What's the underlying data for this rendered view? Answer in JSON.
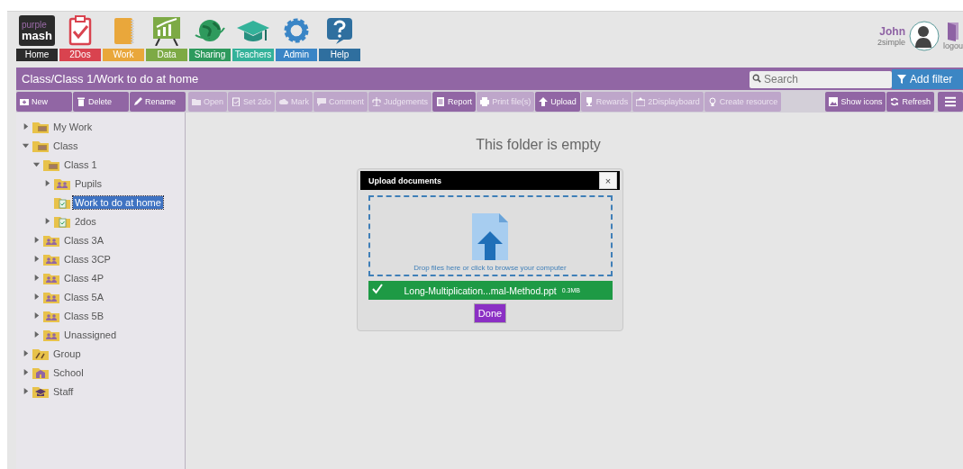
{
  "header": {
    "logo": {
      "line1": "purple",
      "line2": "mash"
    },
    "nav": [
      {
        "label": "Home",
        "color": "#2b2b2b",
        "kind": "logo"
      },
      {
        "label": "2Dos",
        "color": "#d9434f",
        "kind": "clipboard"
      },
      {
        "label": "Work",
        "color": "#e9a73b",
        "kind": "notebook"
      },
      {
        "label": "Data",
        "color": "#7daa45",
        "kind": "chart"
      },
      {
        "label": "Sharing",
        "color": "#2e9a5d",
        "kind": "globe"
      },
      {
        "label": "Teachers",
        "color": "#34b29a",
        "kind": "cap"
      },
      {
        "label": "Admin",
        "color": "#3a85c6",
        "kind": "gear"
      },
      {
        "label": "Help",
        "color": "#2f6f9f",
        "kind": "help"
      }
    ],
    "user": {
      "name": "John",
      "org": "2simple",
      "logout": "logou"
    }
  },
  "path_bar": {
    "path": "Class/Class 1/Work to do at home",
    "search_placeholder": "Search",
    "filter_button": "Add filter"
  },
  "toolbar": {
    "left": [
      {
        "label": "New",
        "kind": "new",
        "disabled": false
      },
      {
        "label": "Delete",
        "kind": "trash",
        "disabled": false
      },
      {
        "label": "Rename",
        "kind": "pencil",
        "disabled": false
      }
    ],
    "main": [
      {
        "label": "Open",
        "kind": "folder",
        "disabled": true
      },
      {
        "label": "Set 2do",
        "kind": "clipboard",
        "disabled": true
      },
      {
        "label": "Mark",
        "kind": "cloud",
        "disabled": true
      },
      {
        "label": "Comment",
        "kind": "speech",
        "disabled": true
      },
      {
        "label": "Judgements",
        "kind": "scale",
        "disabled": true
      },
      {
        "label": "Report",
        "kind": "doc",
        "disabled": false
      },
      {
        "label": "Print file(s)",
        "kind": "printer",
        "disabled": true
      },
      {
        "label": "Upload",
        "kind": "upload",
        "disabled": false
      },
      {
        "label": "Rewards",
        "kind": "trophy",
        "disabled": true
      },
      {
        "label": "2Displayboard",
        "kind": "board",
        "disabled": true
      },
      {
        "label": "Create resource",
        "kind": "bulb",
        "disabled": true
      }
    ],
    "right": [
      {
        "label": "Show icons",
        "kind": "image",
        "disabled": false
      },
      {
        "label": "Refresh",
        "kind": "refresh",
        "disabled": false
      }
    ]
  },
  "tree": [
    {
      "label": "My Work",
      "kind": "files",
      "expanded": false,
      "selected": false
    },
    {
      "label": "Class",
      "kind": "files",
      "expanded": true,
      "selected": false,
      "children": [
        {
          "label": "Class 1",
          "kind": "files",
          "expanded": true,
          "selected": false,
          "children": [
            {
              "label": "Pupils",
              "kind": "people",
              "expanded": false,
              "selected": false
            },
            {
              "label": "Work to do at home",
              "kind": "clipboard",
              "selected": true
            },
            {
              "label": "2dos",
              "kind": "clipboard",
              "expanded": false,
              "selected": false
            }
          ]
        },
        {
          "label": "Class 3A",
          "kind": "people",
          "expanded": false,
          "selected": false
        },
        {
          "label": "Class 3CP",
          "kind": "people",
          "expanded": false,
          "selected": false
        },
        {
          "label": "Class 4P",
          "kind": "people",
          "expanded": false,
          "selected": false
        },
        {
          "label": "Class 5A",
          "kind": "people",
          "expanded": false,
          "selected": false
        },
        {
          "label": "Class 5B",
          "kind": "people",
          "expanded": false,
          "selected": false
        },
        {
          "label": "Unassigned",
          "kind": "people",
          "expanded": false,
          "selected": false
        }
      ]
    },
    {
      "label": "Group",
      "kind": "group",
      "expanded": false,
      "selected": false
    },
    {
      "label": "School",
      "kind": "school",
      "expanded": false,
      "selected": false
    },
    {
      "label": "Staff",
      "kind": "cap",
      "expanded": false,
      "selected": false
    }
  ],
  "content": {
    "empty_message": "This folder is empty"
  },
  "dialog": {
    "title": "Upload documents",
    "close": "×",
    "drop_hint": "Drop files here or click to browse your computer",
    "file": {
      "done": true,
      "name": "Long-Multiplication...mal-Method.ppt",
      "size": "0.3MB"
    },
    "done_button": "Done"
  }
}
